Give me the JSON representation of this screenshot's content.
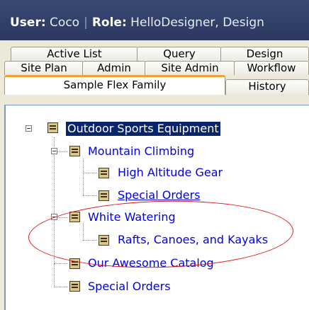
{
  "header": {
    "user_label": "User:",
    "user_value": "Coco",
    "separator": "|",
    "role_label": "Role:",
    "role_value": "HelloDesigner, Design"
  },
  "tabs": {
    "row1": [
      "Active List",
      "Query",
      "Design"
    ],
    "row2": [
      "Site Plan",
      "Admin",
      "Site Admin",
      "Workflow"
    ],
    "row3": [
      "Sample Flex Family",
      "History"
    ],
    "selected": "Sample Flex Family"
  },
  "tree": {
    "root": "Outdoor Sports Equipment",
    "mountain": "Mountain Climbing",
    "high_altitude": "High Altitude Gear",
    "special_orders_1": "Special Orders",
    "white_watering": "White Watering",
    "rafts": "Rafts, Canoes, and Kayaks",
    "catalog": "Our Awesome Catalog",
    "special_orders_2": "Special Orders"
  },
  "colors": {
    "header_bg": "#2f3c67",
    "tab_accent": "#f0a030",
    "link": "#0000e6",
    "selection": "#0a246a",
    "highlight_ellipse": "#e01414"
  }
}
